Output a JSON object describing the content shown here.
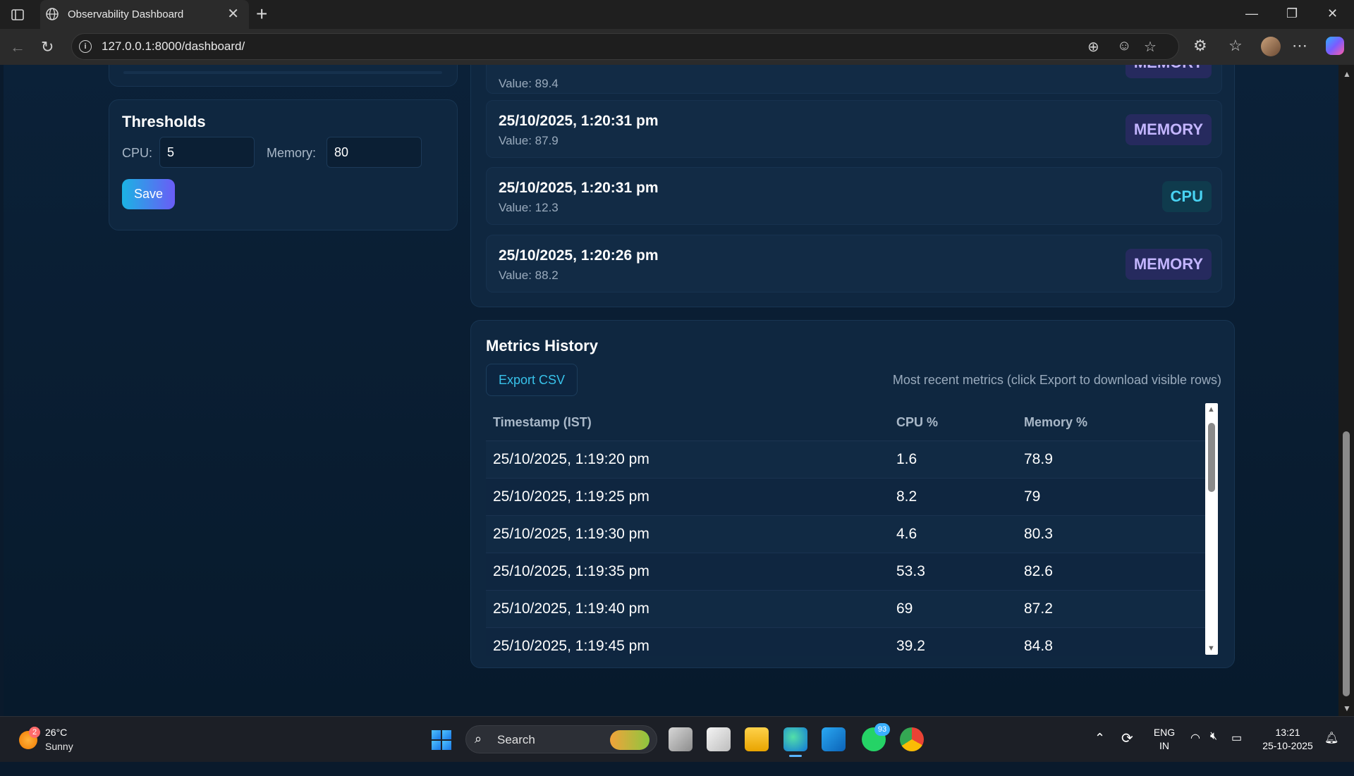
{
  "browser": {
    "tab_title": "Observability Dashboard",
    "url": "127.0.0.1:8000/dashboard/",
    "new_tab_symbol": "+",
    "close_symbol": "✕"
  },
  "thresholds": {
    "title": "Thresholds",
    "cpu_label": "CPU:",
    "cpu_value": "5",
    "memory_label": "Memory:",
    "memory_value": "80",
    "save_label": "Save"
  },
  "alerts": {
    "partial_top": {
      "badge": "MEMORY",
      "value": "Value: 89.4"
    },
    "items": [
      {
        "timestamp": "25/10/2025, 1:20:31 pm",
        "value": "Value: 87.9",
        "badge": "MEMORY",
        "type": "memory"
      },
      {
        "timestamp": "25/10/2025, 1:20:31 pm",
        "value": "Value: 12.3",
        "badge": "CPU",
        "type": "cpu"
      },
      {
        "timestamp": "25/10/2025, 1:20:26 pm",
        "value": "Value: 88.2",
        "badge": "MEMORY",
        "type": "memory"
      }
    ]
  },
  "metrics": {
    "title": "Metrics History",
    "export_label": "Export CSV",
    "hint": "Most recent metrics (click Export to download visible rows)",
    "columns": [
      "Timestamp (IST)",
      "CPU %",
      "Memory %"
    ],
    "rows": [
      [
        "25/10/2025, 1:19:20 pm",
        "1.6",
        "78.9"
      ],
      [
        "25/10/2025, 1:19:25 pm",
        "8.2",
        "79"
      ],
      [
        "25/10/2025, 1:19:30 pm",
        "4.6",
        "80.3"
      ],
      [
        "25/10/2025, 1:19:35 pm",
        "53.3",
        "82.6"
      ],
      [
        "25/10/2025, 1:19:40 pm",
        "69",
        "87.2"
      ],
      [
        "25/10/2025, 1:19:45 pm",
        "39.2",
        "84.8"
      ]
    ]
  },
  "taskbar": {
    "weather_badge": "2",
    "temperature": "26°C",
    "condition": "Sunny",
    "search_label": "Search",
    "whatsapp_badge": "93",
    "lang_line1": "ENG",
    "lang_line2": "IN",
    "time": "13:21",
    "date": "25-10-2025"
  }
}
